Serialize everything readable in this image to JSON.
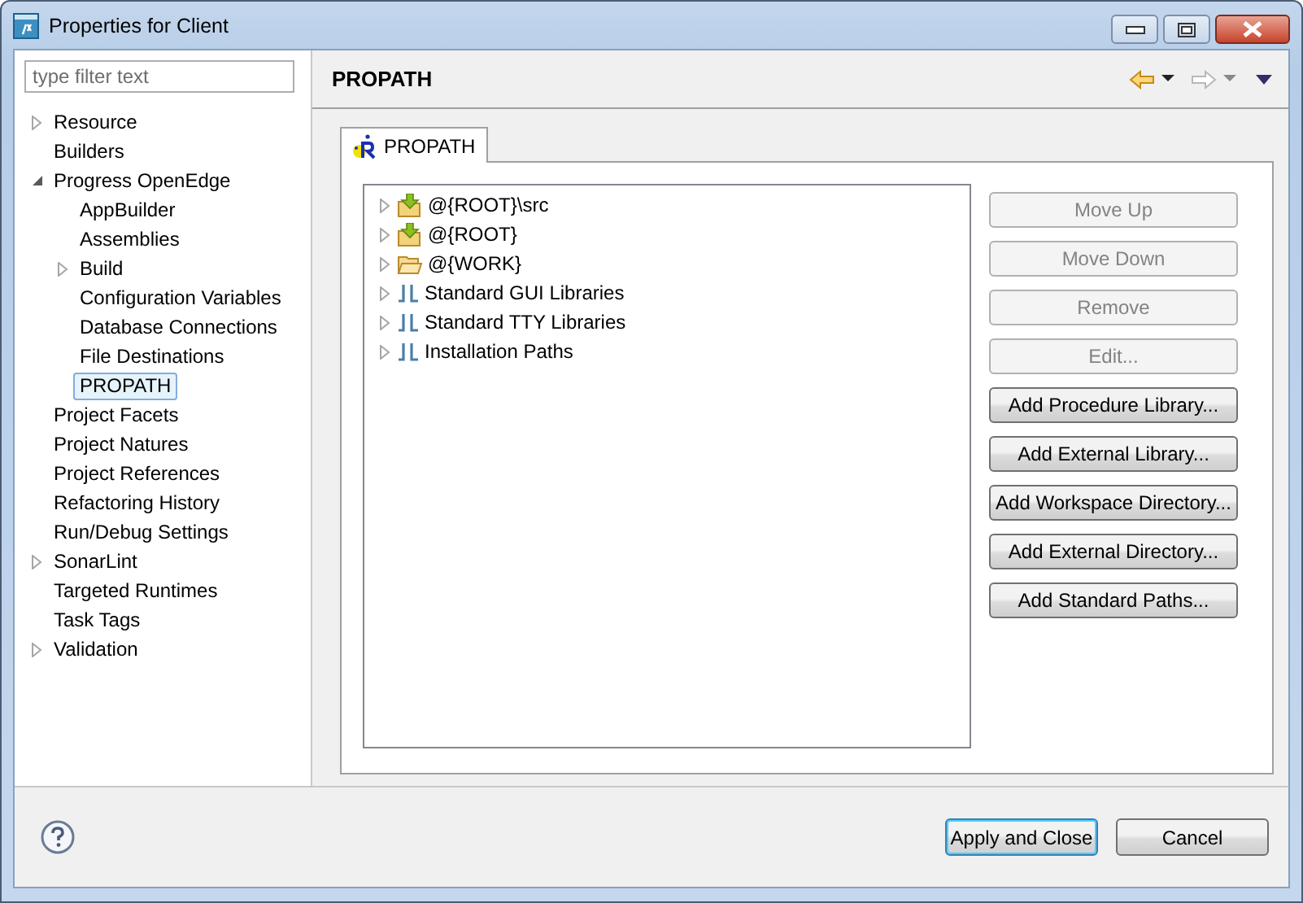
{
  "window": {
    "title": "Properties for Client"
  },
  "filter": {
    "placeholder": "type filter text"
  },
  "sidebar": {
    "items": [
      {
        "label": "Resource",
        "expanded": false,
        "selected": false
      },
      {
        "label": "Builders",
        "selected": false
      },
      {
        "label": "Progress OpenEdge",
        "expanded": true,
        "selected": false,
        "children": [
          {
            "label": "AppBuilder",
            "selected": false
          },
          {
            "label": "Assemblies",
            "selected": false
          },
          {
            "label": "Build",
            "expanded": false,
            "selected": false
          },
          {
            "label": "Configuration Variables",
            "selected": false
          },
          {
            "label": "Database Connections",
            "selected": false
          },
          {
            "label": "File Destinations",
            "selected": false
          },
          {
            "label": "PROPATH",
            "selected": true
          }
        ]
      },
      {
        "label": "Project Facets",
        "selected": false
      },
      {
        "label": "Project Natures",
        "selected": false
      },
      {
        "label": "Project References",
        "selected": false
      },
      {
        "label": "Refactoring History",
        "selected": false
      },
      {
        "label": "Run/Debug Settings",
        "selected": false
      },
      {
        "label": "SonarLint",
        "expanded": false,
        "selected": false
      },
      {
        "label": "Targeted Runtimes",
        "selected": false
      },
      {
        "label": "Task Tags",
        "selected": false
      },
      {
        "label": "Validation",
        "expanded": false,
        "selected": false
      }
    ]
  },
  "page": {
    "title": "PROPATH",
    "tabs": [
      {
        "label": "PROPATH",
        "selected": true
      }
    ],
    "paths": [
      {
        "label": "@{ROOT}\\src",
        "kind": "source",
        "expanded": false
      },
      {
        "label": "@{ROOT}",
        "kind": "source",
        "expanded": false
      },
      {
        "label": "@{WORK}",
        "kind": "folder",
        "expanded": false
      },
      {
        "label": "Standard GUI Libraries",
        "kind": "library",
        "expanded": false
      },
      {
        "label": "Standard TTY Libraries",
        "kind": "library",
        "expanded": false
      },
      {
        "label": "Installation Paths",
        "kind": "library",
        "expanded": false
      }
    ],
    "buttons": [
      {
        "label": "Move Up",
        "disabled": true
      },
      {
        "label": "Move Down",
        "disabled": true
      },
      {
        "label": "Remove",
        "disabled": true
      },
      {
        "label": "Edit...",
        "disabled": true
      },
      {
        "label": "Add Procedure Library...",
        "disabled": false
      },
      {
        "label": "Add External Library...",
        "disabled": false
      },
      {
        "label": "Add Workspace Directory...",
        "disabled": false
      },
      {
        "label": "Add External Directory...",
        "disabled": false
      },
      {
        "label": "Add Standard Paths...",
        "disabled": false
      }
    ]
  },
  "footer": {
    "buttons": [
      {
        "label": "Apply and Close",
        "default": true
      },
      {
        "label": "Cancel",
        "default": false
      }
    ]
  }
}
